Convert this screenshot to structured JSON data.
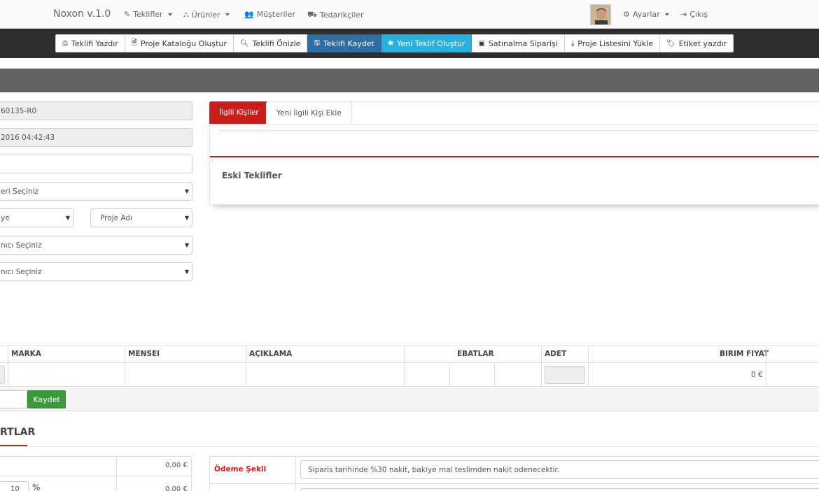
{
  "brand": "Noxon v.1.0",
  "nav": {
    "teklifler": "Teklifler",
    "urunler": "Ürünler",
    "musteriler": "Müşteriler",
    "tedarikciler": "Tedarikçiler",
    "ayarlar": "Ayarlar",
    "cikis": "Çıkış"
  },
  "toolbar": {
    "teklifi_yazdir": "Teklifi Yazdır",
    "proje_katalogu": "Proje Kataloğu Oluştur",
    "teklifi_onizle": "Teklifi Önizle",
    "teklifi_kaydet": "Teklifi Kaydet",
    "yeni_teklif": "Yeni Teklif Oluştur",
    "satinalma": "Satınalma Siparişi",
    "proje_listesi": "Proje Listesini Yükle",
    "etiket": "Etiket yazdır"
  },
  "form": {
    "teklif_no": "60135-R0",
    "tarih": "2016 04:42:43",
    "bos_alan": "",
    "musteri_sec": "eri Seçiniz",
    "sol_select": "ye",
    "proje_adi": "Proje Adı",
    "kullanici_sec_1": "nıcı Seçiniz",
    "kullanici_sec_2": "nıcı Seçiniz"
  },
  "tabs": {
    "ilgili_kisiler": "İlgili Kişiler",
    "yeni_ilgili_kisi": "Yeni İlgili Kişi Ekle"
  },
  "eski_teklifler": "Eski Teklifler",
  "table": {
    "headers": {
      "marka": "MARKA",
      "mensei": "MENSEI",
      "aciklama": "AÇIKLAMA",
      "ebatlar": "EBATLAR",
      "adet": "ADET",
      "birim_fiyat": "BIRIM FIYAT"
    },
    "row": {
      "birim_fiyat": "0 €"
    },
    "kaydet": "Kaydet"
  },
  "sartlar": {
    "title": "RTLAR",
    "toplam_1": "0,00 €",
    "toplam_2": "0,00 €",
    "oran": "10",
    "yuzde": "%",
    "odeme_label": "Ödeme Şekli",
    "odeme_value": "Siparis tarihinde %30 nakit, bakiye mal teslimden nakit odenecektir."
  },
  "colors": {
    "accent_red": "#c81e1e",
    "save_blue": "#2f6da3",
    "new_cyan": "#2bb1e0",
    "kaydet_green": "#3c9a3c"
  }
}
